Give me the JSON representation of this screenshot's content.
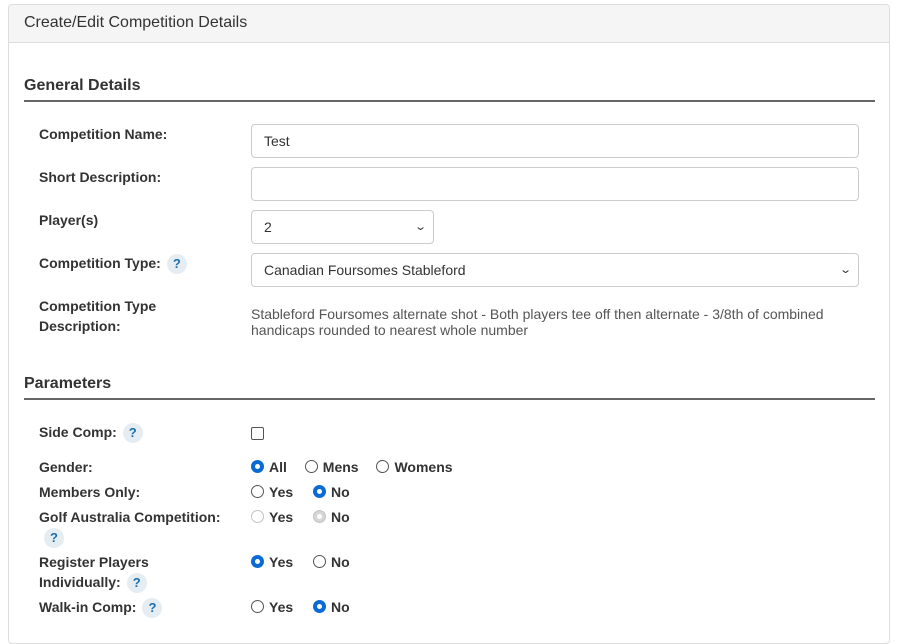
{
  "panel": {
    "title": "Create/Edit Competition Details"
  },
  "general": {
    "heading": "General Details",
    "competition_name_label": "Competition Name:",
    "competition_name_value": "Test",
    "short_description_label": "Short Description:",
    "short_description_value": "",
    "players_label": "Player(s)",
    "players_value": "2",
    "competition_type_label": "Competition Type:",
    "competition_type_value": "Canadian Foursomes Stableford",
    "type_description_label_line1": "Competition Type",
    "type_description_label_line2": "Description:",
    "type_description_line1": "Stableford Foursomes alternate shot - Both players tee off then alternate - 3/8th of combined",
    "type_description_line2": "handicaps rounded to nearest whole number"
  },
  "parameters": {
    "heading": "Parameters",
    "side_comp_label": "Side Comp:",
    "side_comp_checked": false,
    "gender_label": "Gender:",
    "gender_options": [
      "All",
      "Mens",
      "Womens"
    ],
    "gender_selected": "All",
    "members_only_label": "Members Only:",
    "members_only_selected": "No",
    "golf_australia_label": "Golf Australia Competition:",
    "golf_australia_selected": "No",
    "golf_australia_disabled": true,
    "register_individually_label_line1": "Register Players",
    "register_individually_label_line2": "Individually:",
    "register_individually_selected": "Yes",
    "walk_in_label": "Walk-in Comp:",
    "walk_in_selected": "No",
    "yes_label": "Yes",
    "no_label": "No"
  },
  "help_glyph": "?",
  "icons": {
    "dropdown": "chevron-down-icon",
    "help": "help-icon"
  },
  "colors": {
    "accent": "#0b6bd4",
    "help_badge_bg": "#e6edf2",
    "help_badge_fg": "#1a6fb0"
  }
}
